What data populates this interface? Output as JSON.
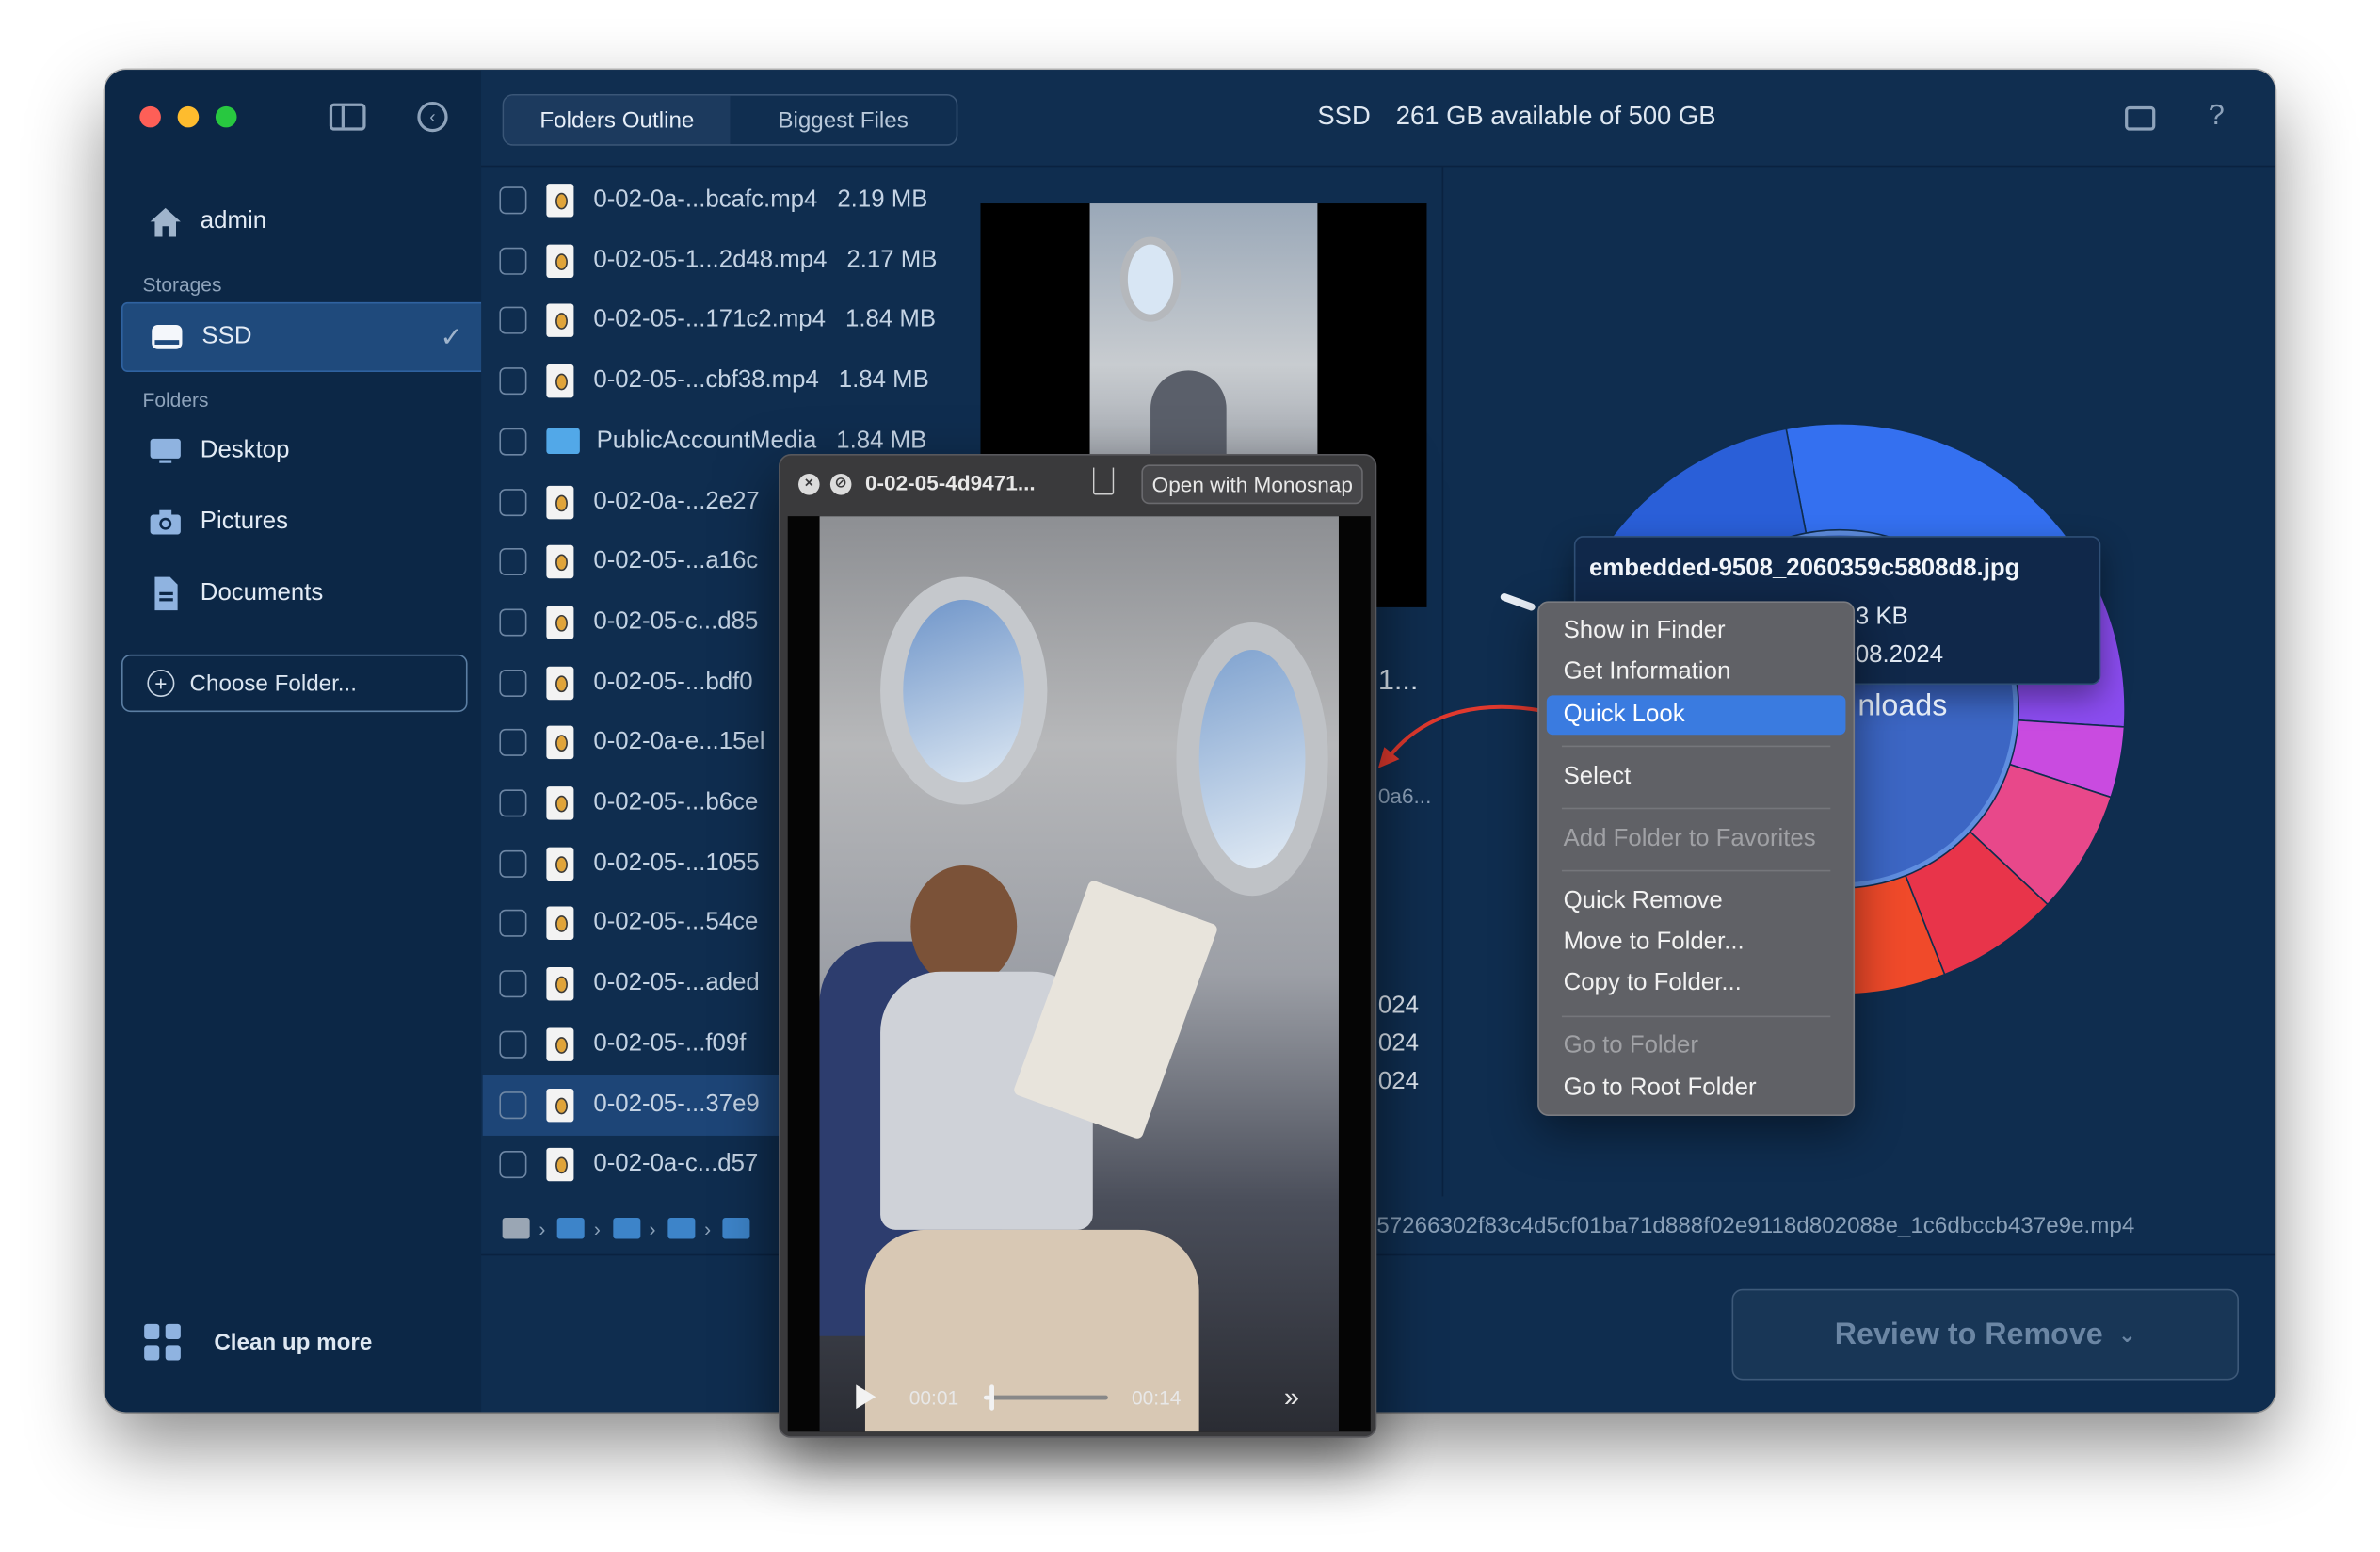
{
  "window": {
    "tabs": [
      "Folders Outline",
      "Biggest Files"
    ],
    "active_tab": 0,
    "disk_name": "SSD",
    "disk_space": "261 GB available of 500 GB"
  },
  "sidebar": {
    "user": "admin",
    "storages_label": "Storages",
    "storage": "SSD",
    "folders_label": "Folders",
    "folders": [
      {
        "label": "Desktop",
        "icon": "desktop-icon"
      },
      {
        "label": "Pictures",
        "icon": "camera-icon"
      },
      {
        "label": "Documents",
        "icon": "document-icon"
      }
    ],
    "choose_folder": "Choose Folder...",
    "cleanup": "Clean up more"
  },
  "files": [
    {
      "name": "0-02-0a-...bcafc.mp4",
      "size": "2.19 MB"
    },
    {
      "name": "0-02-05-1...2d48.mp4",
      "size": "2.17 MB"
    },
    {
      "name": "0-02-05-...171c2.mp4",
      "size": "1.84 MB"
    },
    {
      "name": "0-02-05-...cbf38.mp4",
      "size": "1.84 MB"
    },
    {
      "name": "PublicAccountMedia",
      "size": "1.84 MB",
      "folder": true
    },
    {
      "name": "0-02-0a-...2e27",
      "size": ""
    },
    {
      "name": "0-02-05-...a16c",
      "size": ""
    },
    {
      "name": "0-02-05-c...d85",
      "size": ""
    },
    {
      "name": "0-02-05-...bdf0",
      "size": ""
    },
    {
      "name": "0-02-0a-e...15el",
      "size": ""
    },
    {
      "name": "0-02-05-...b6ce",
      "size": ""
    },
    {
      "name": "0-02-05-...1055",
      "size": ""
    },
    {
      "name": "0-02-05-...54ce",
      "size": ""
    },
    {
      "name": "0-02-05-...aded",
      "size": ""
    },
    {
      "name": "0-02-05-...f09f",
      "size": ""
    },
    {
      "name": "0-02-05-...37e9",
      "size": "",
      "highlighted": true
    },
    {
      "name": "0-02-0a-c...d57",
      "size": ""
    }
  ],
  "details": {
    "title_partial": "1...",
    "hash_partial": "0a6...",
    "dates_partial": [
      "024",
      "024",
      "024"
    ],
    "path_tail": "57266302f83c4d5cf01ba71d888f02e9118d802088e_1c6dbccb437e9e.mp4"
  },
  "tooltip": {
    "filename": "embedded-9508_2060359c5808d8.jpg",
    "size": ".3 KB",
    "date": ".08.2024",
    "folder": "nloads"
  },
  "context_menu": {
    "groups": [
      [
        "Show in Finder",
        "Get Information",
        "Quick Look"
      ],
      [
        "Select"
      ],
      [
        "Add Folder to Favorites"
      ],
      [
        "Quick Remove",
        "Move to Folder...",
        "Copy to Folder..."
      ],
      [
        "Go to Folder",
        "Go to Root Folder"
      ]
    ],
    "active": "Quick Look",
    "disabled": [
      "Add Folder to Favorites",
      "Go to Folder"
    ]
  },
  "quicklook": {
    "title": "0-02-05-4d9471...",
    "open_with": "Open with Monosnap",
    "time_current": "00:01",
    "time_total": "00:14",
    "progress": 0.07
  },
  "review_button": "Review to Remove",
  "chart_data": {
    "type": "pie",
    "note": "sunburst disk usage wheel",
    "segments": [
      {
        "color": "#3470f0",
        "value": 18
      },
      {
        "color": "#8b4cf0",
        "value": 11
      },
      {
        "color": "#c94be0",
        "value": 4
      },
      {
        "color": "#e8488a",
        "value": 7
      },
      {
        "color": "#e8344a",
        "value": 7
      },
      {
        "color": "#f04a2a",
        "value": 6
      },
      {
        "color": "#f07a2a",
        "value": 5
      },
      {
        "color": "#f2a330",
        "value": 5
      },
      {
        "color": "#f5cc3a",
        "value": 5
      },
      {
        "color": "#eef04a",
        "value": 7
      },
      {
        "color": "#2a5fd8",
        "value": 25
      }
    ]
  },
  "colors": {
    "accent": "#3a7be0",
    "window_bg": "#0f2d4f",
    "sidebar_bg": "#0c2746"
  }
}
